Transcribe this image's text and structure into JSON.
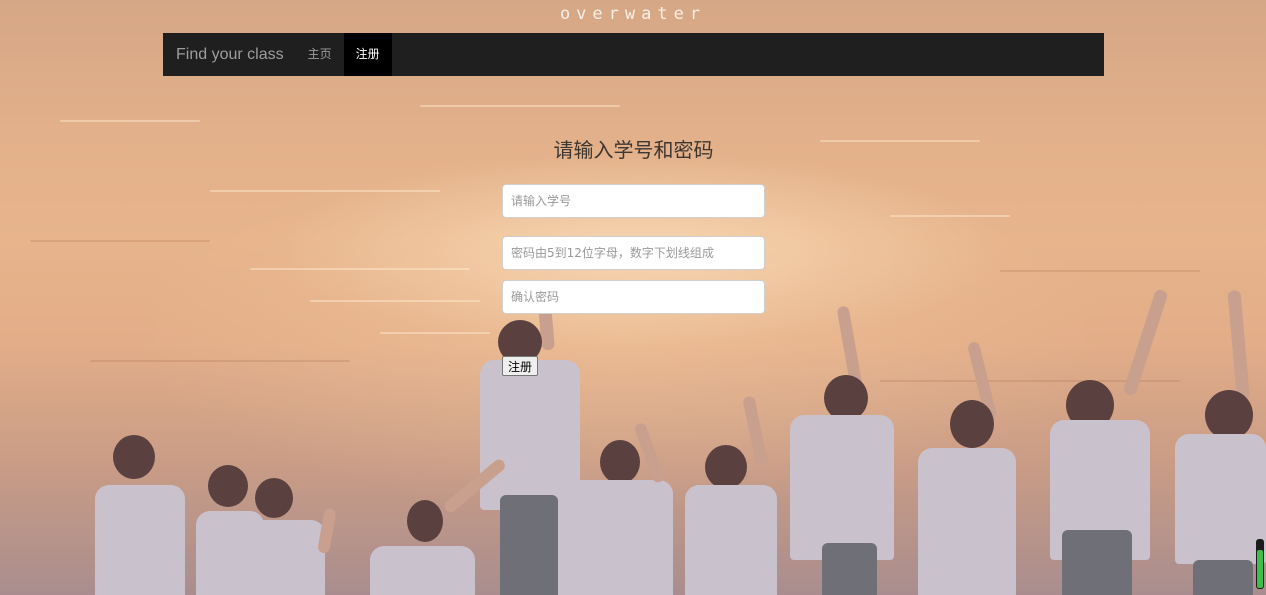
{
  "site": {
    "title": "overwater"
  },
  "navbar": {
    "brand": "Find your class",
    "links": [
      {
        "label": "主页",
        "active": false
      },
      {
        "label": "注册",
        "active": true
      }
    ]
  },
  "form": {
    "heading": "请输入学号和密码",
    "student_id": {
      "value": "",
      "placeholder": "请输入学号"
    },
    "password": {
      "value": "",
      "placeholder": "密码由5到12位字母，数字下划线组成"
    },
    "confirm_password": {
      "value": "",
      "placeholder": "确认密码"
    },
    "submit_label": "注册"
  },
  "background": {
    "description": "sunset-lake-photo-with-group-jumping",
    "accent_colors": [
      "#e7b48c",
      "#a98d8e"
    ]
  },
  "scroll_indicator": {
    "level": 0.8
  }
}
